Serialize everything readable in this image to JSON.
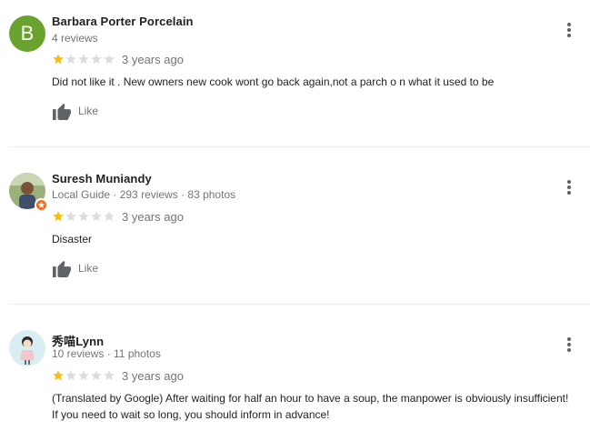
{
  "reviews": [
    {
      "author": "Barbara Porter Porcelain",
      "avatar_letter": "B",
      "meta": "4 reviews",
      "rating": 1,
      "time": "3 years ago",
      "text": "Did not like it . New owners  new cook  wont go back again,not  a parch o n what it used to be",
      "like_label": "Like"
    },
    {
      "author": "Suresh Muniandy",
      "meta_guide": "Local Guide",
      "meta_rest": " · 293 reviews · 83 photos",
      "rating": 1,
      "time": "3 years ago",
      "text": "Disaster",
      "like_label": "Like"
    },
    {
      "author": "秀喵Lynn",
      "meta": "10 reviews · 11 photos",
      "rating": 1,
      "time": "3 years ago",
      "text": "(Translated by Google) After waiting for half an hour to have a soup, the manpower is obviously insufficient! If you need to wait so long, you should inform in advance!"
    }
  ],
  "colors": {
    "star_filled": "#fbbc04",
    "star_empty": "#dadce0",
    "avatar_b": "#69a22f",
    "guide_badge": "#f26b1d",
    "secondary_text": "#70757a"
  },
  "icons": {
    "like": "thumbs-up-icon",
    "menu": "more-vert-icon",
    "star": "star-icon"
  }
}
